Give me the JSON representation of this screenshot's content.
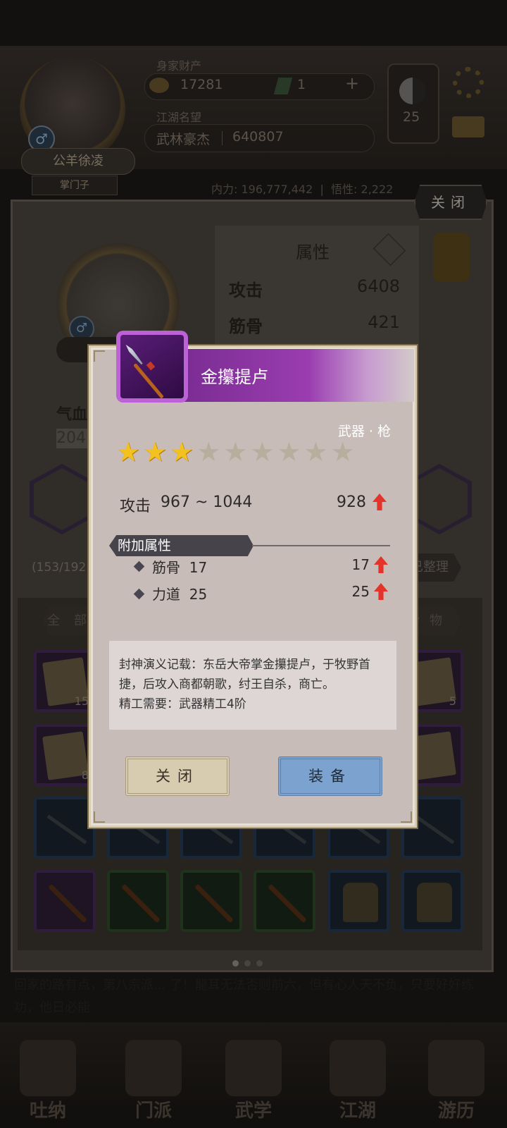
{
  "header": {
    "wealth_label": "身家财产",
    "coins": "17281",
    "jade": "1",
    "plus": "+",
    "fame_label": "江湖名望",
    "fame_title": "武林豪杰",
    "fame_value": "640807",
    "level": "25",
    "player_name": "公羊徐凌",
    "player_rank": "掌门子"
  },
  "stats_row": {
    "internal_label": "内力",
    "internal_value": "196,777,442",
    "grade_label": "悟性",
    "grade_value": "2,222"
  },
  "top_close_label": "关闭",
  "attributes": {
    "title": "属性",
    "rows": [
      {
        "label": "攻击",
        "value": "6408"
      },
      {
        "label": "筋骨",
        "value": "421"
      }
    ],
    "hp_label": "气血",
    "hp_value": "204"
  },
  "bag": {
    "count": "(153/192",
    "sort_label": "已整理",
    "tab_all": "全部",
    "tab_misc": "杂物",
    "slot_counts": [
      "15",
      "5",
      "8"
    ]
  },
  "story_text": "回家的路有点，第八宗派... 了！龍耳无法否则前六，但有心人天不负，只要好好练功，他日必能",
  "nav": {
    "items": [
      "吐纳",
      "门派",
      "武学",
      "江湖",
      "游历"
    ]
  },
  "modal": {
    "item_name": "金攥提卢",
    "item_type": "武器 · 枪",
    "stars_total": 9,
    "stars_filled": 3,
    "attack_label": "攻击",
    "attack_range": "967 ~ 1044",
    "attack_value": "928",
    "bonus_title": "附加属性",
    "bonuses": [
      {
        "name": "筋骨",
        "base": "17",
        "value": "17"
      },
      {
        "name": "力道",
        "base": "25",
        "value": "25"
      }
    ],
    "description": "封神演义记载：东岳大帝掌金攥提卢，于牧野首捷，后攻入商都朝歌，纣王自杀，商亡。",
    "requirement": "精工需要：武器精工4阶",
    "close_label": "关闭",
    "equip_label": "装备"
  },
  "colors": {
    "title_purple": "#9a3db0",
    "star_gold": "#f4c21e",
    "up_red": "#e4332a",
    "equip_blue": "#7ca3cf"
  }
}
